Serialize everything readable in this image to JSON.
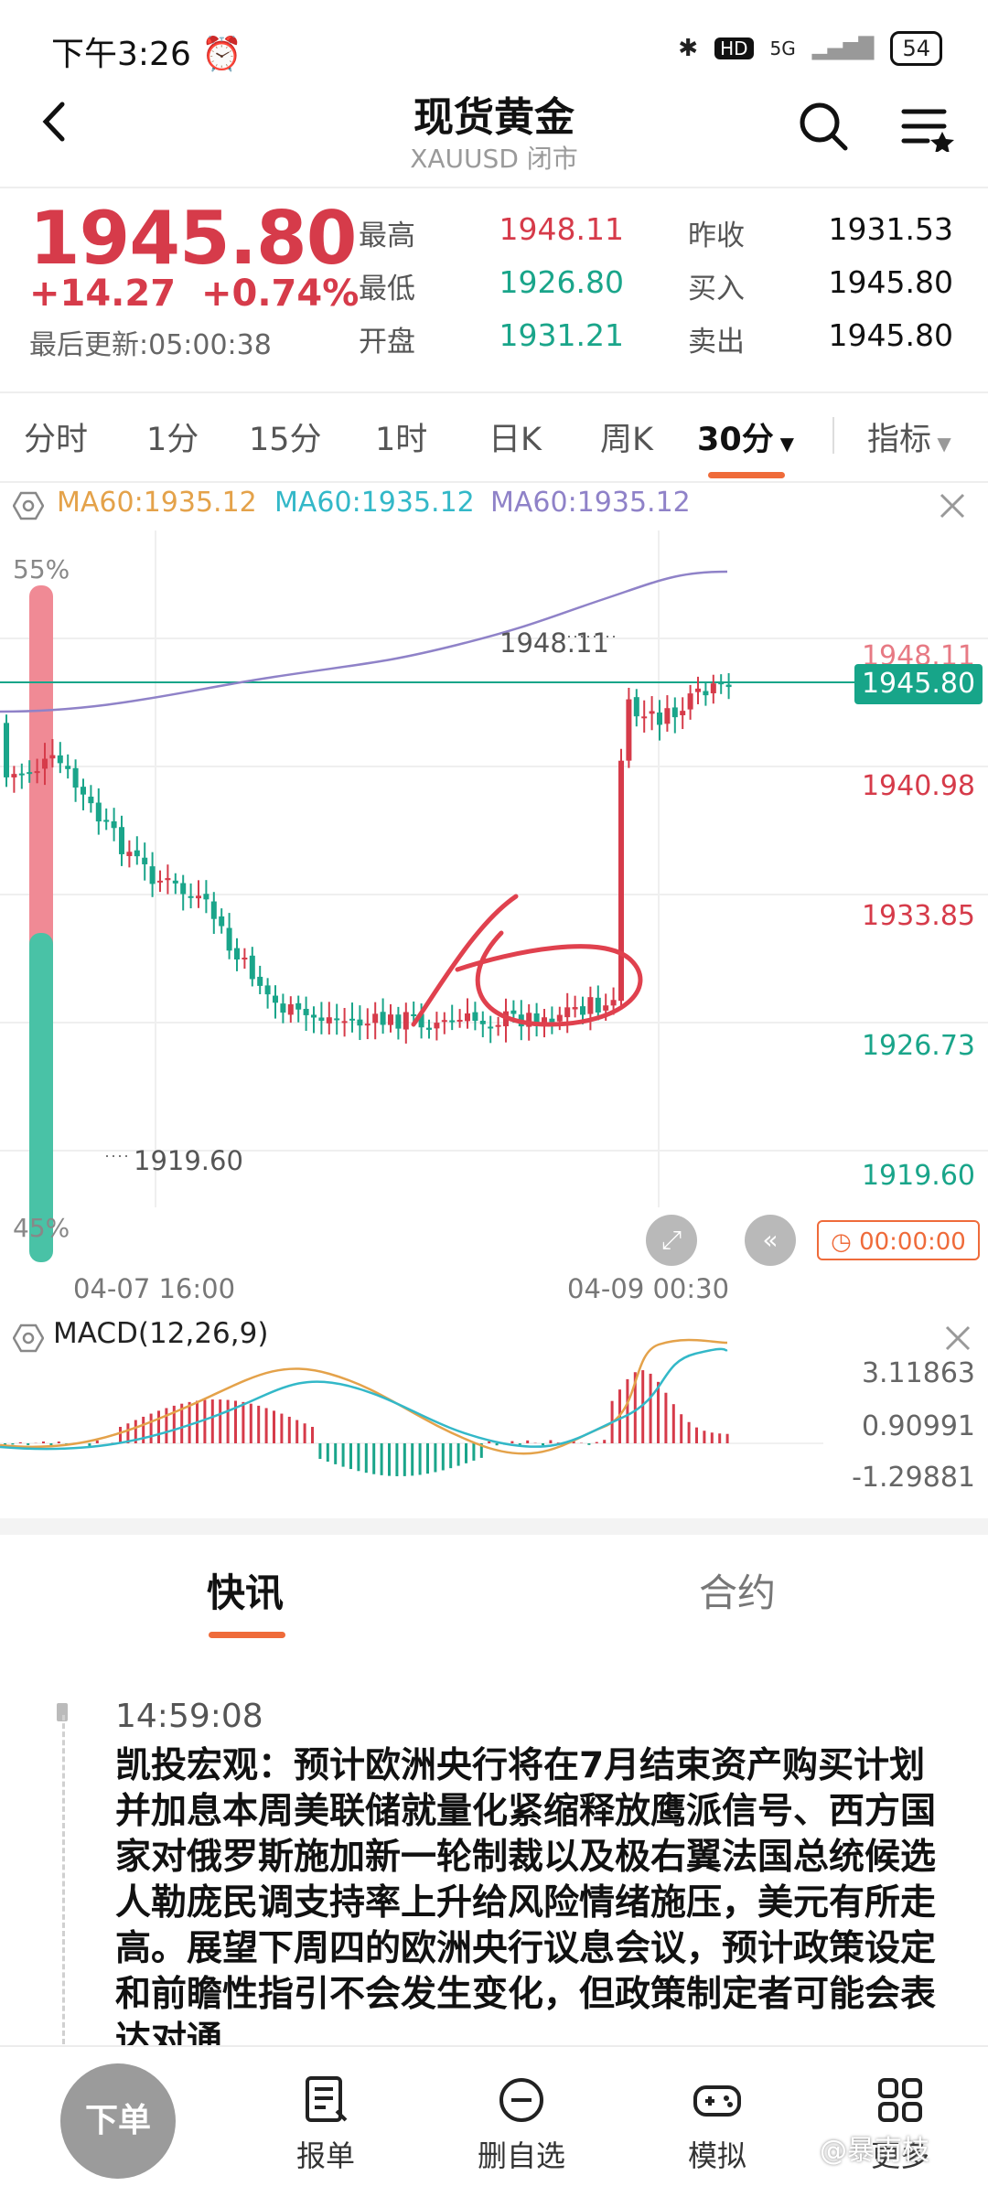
{
  "status": {
    "time": "下午3:26",
    "hd": "HD",
    "net": "5G",
    "battery": "54"
  },
  "nav": {
    "title": "现货黄金",
    "subtitle": "XAUUSD 闭市"
  },
  "quote": {
    "price": "1945.80",
    "change": "+14.27",
    "change_pct": "+0.74%",
    "updated": "最后更新:05:00:38",
    "rows": [
      {
        "l1": "最高",
        "v1": "1948.11",
        "l2": "昨收",
        "v2": "1931.53"
      },
      {
        "l1": "最低",
        "v1": "1926.80",
        "l2": "买入",
        "v2": "1945.80"
      },
      {
        "l1": "开盘",
        "v1": "1931.21",
        "l2": "卖出",
        "v2": "1945.80"
      }
    ]
  },
  "tabs": [
    "分时",
    "1分",
    "15分",
    "1时",
    "日K",
    "周K",
    "30分",
    "指标"
  ],
  "ma": [
    "MA60:1935.12",
    "MA60:1935.12",
    "MA60:1935.12"
  ],
  "colors": {
    "up": "#d63b4a",
    "down": "#1aa58a",
    "accent": "#ef6b3a",
    "ma": "#8f82c8"
  },
  "chart": {
    "pct_top": "55%",
    "pct_bottom": "45%",
    "axis": [
      "1948.11",
      "1940.98",
      "1933.85",
      "1926.73",
      "1919.60"
    ],
    "current": "1945.80",
    "high_label": "1948.11",
    "low_label": "1919.60",
    "x_labels": [
      "04-07 16:00",
      "04-09 00:30"
    ],
    "timer": "00:00:00"
  },
  "macd": {
    "title": "MACD(12,26,9)",
    "axis": [
      "3.11863",
      "0.90991",
      "-1.29881"
    ]
  },
  "news": {
    "tabs": [
      "快讯",
      "合约"
    ],
    "time": "14:59:08",
    "body": "凯投宏观：预计欧洲央行将在7月结束资产购买计划并加息本周美联储就量化紧缩释放鹰派信号、西方国家对俄罗斯施加新一轮制裁以及极右翼法国总统候选人勒庞民调支持率上升给风险情绪施压，美元有所走高。展望下周四的欧洲央行议息会议，预计政策设定和前瞻性指引不会发生变化，但政策制定者可能会表达对通"
  },
  "bottom": {
    "order": "下单",
    "items": [
      "报单",
      "删自选",
      "模拟",
      "更多"
    ],
    "watermark": "@暴南枝"
  }
}
